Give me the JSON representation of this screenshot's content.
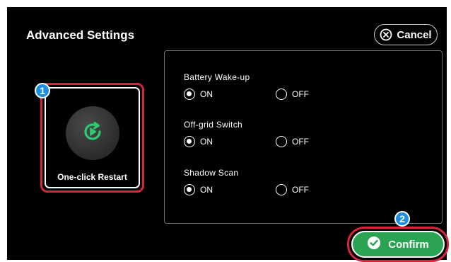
{
  "header": {
    "title": "Advanced Settings",
    "cancel_label": "Cancel"
  },
  "restart": {
    "label": "One-click Restart",
    "badge": "1"
  },
  "options": [
    {
      "label": "Battery Wake-up",
      "on_label": "ON",
      "off_label": "OFF",
      "selected": "ON"
    },
    {
      "label": "Off-grid Switch",
      "on_label": "ON",
      "off_label": "OFF",
      "selected": "ON"
    },
    {
      "label": "Shadow Scan",
      "on_label": "ON",
      "off_label": "OFF",
      "selected": "ON"
    }
  ],
  "footer": {
    "confirm_label": "Confirm",
    "badge": "2"
  },
  "colors": {
    "background": "#000000",
    "accent_green": "#2aa352",
    "highlight_red": "#d6263b",
    "badge_blue": "#1a8fe6",
    "icon_green": "#2ecc71"
  }
}
